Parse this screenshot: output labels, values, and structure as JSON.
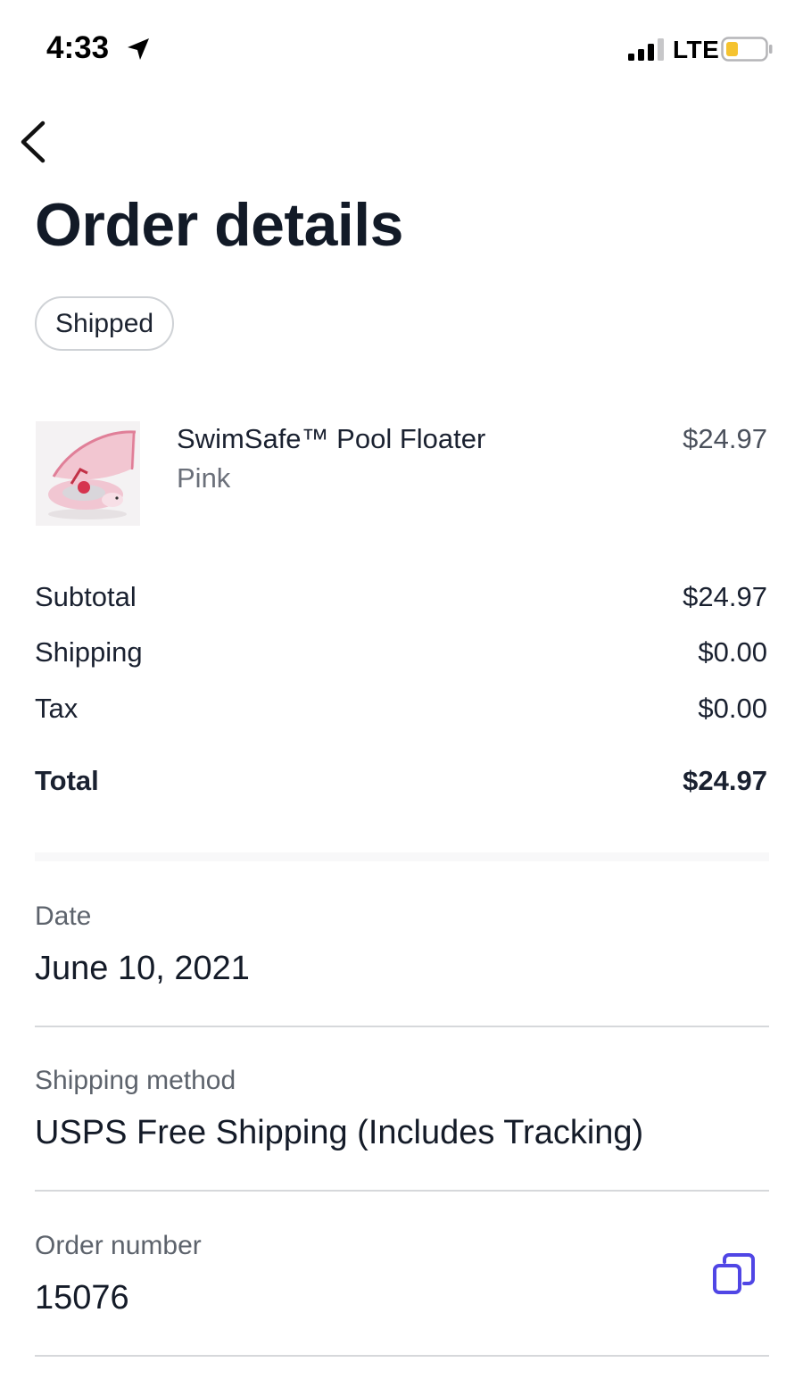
{
  "status_bar": {
    "time": "4:33",
    "network": "LTE",
    "icons": [
      "location-arrow-icon",
      "cellular-signal-icon",
      "battery-low-icon"
    ],
    "battery_color": "#f5c330"
  },
  "nav": {
    "back_icon": "chevron-left-icon"
  },
  "page": {
    "title": "Order details",
    "status": "Shipped"
  },
  "item": {
    "name": "SwimSafe™ Pool Floater",
    "variant": "Pink",
    "price": "$24.97"
  },
  "summary": {
    "subtotal_label": "Subtotal",
    "subtotal_value": "$24.97",
    "shipping_label": "Shipping",
    "shipping_value": "$0.00",
    "tax_label": "Tax",
    "tax_value": "$0.00",
    "total_label": "Total",
    "total_value": "$24.97"
  },
  "details": {
    "date_label": "Date",
    "date_value": "June 10, 2021",
    "shipping_method_label": "Shipping method",
    "shipping_method_value": "USPS Free Shipping (Includes Tracking)",
    "order_number_label": "Order number",
    "order_number_value": "15076"
  },
  "colors": {
    "accent": "#5046e5",
    "text": "#161d2a",
    "muted": "#5d636c",
    "divider": "#d6d8db"
  }
}
